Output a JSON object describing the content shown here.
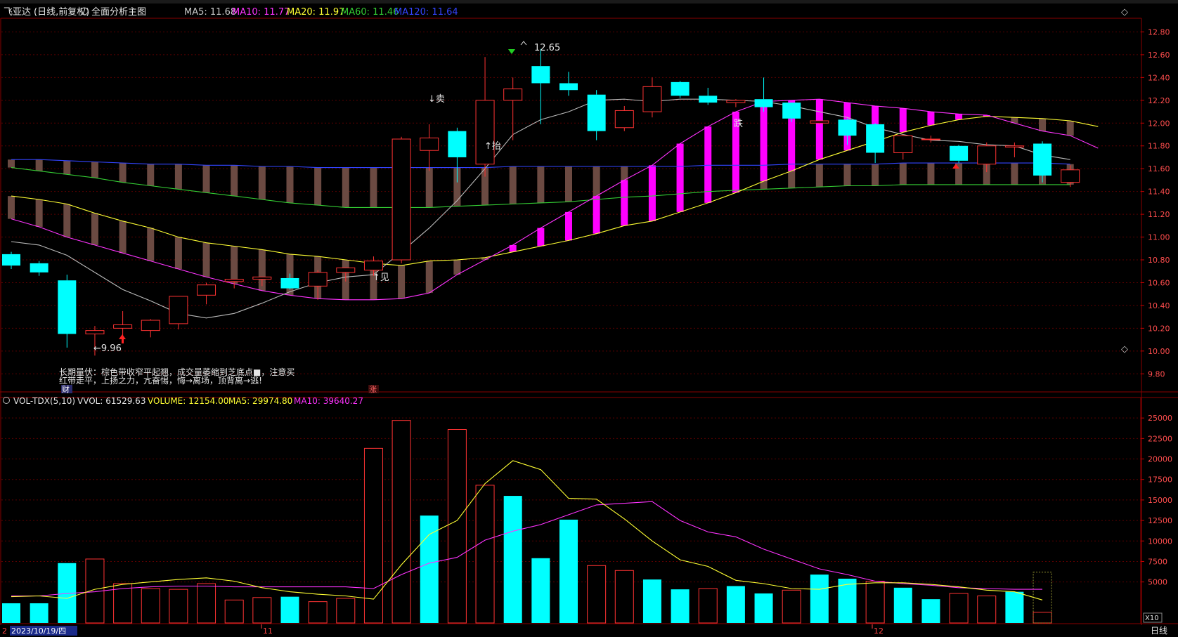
{
  "header": {
    "stock_name": "飞亚达",
    "period": "(日线,前复权)",
    "view_label": "全面分析主图",
    "ma": [
      {
        "label": "MA5: 11.68",
        "color": "#c8c8c8"
      },
      {
        "label": "MA10: 11.77",
        "color": "#ff33ff"
      },
      {
        "label": "MA20: 11.97",
        "color": "#ffff33"
      },
      {
        "label": "MA60: 11.46",
        "color": "#33cc33"
      },
      {
        "label": "MA120: 11.64",
        "color": "#3344ff"
      }
    ]
  },
  "price_axis": {
    "ticks": [
      "12.80",
      "12.60",
      "12.40",
      "12.20",
      "12.00",
      "11.80",
      "11.60",
      "11.40",
      "11.20",
      "11.00",
      "10.80",
      "10.60",
      "10.40",
      "10.20",
      "10.00",
      "9.80"
    ]
  },
  "annotations": {
    "high_label": "12.65",
    "low_label": "←9.96",
    "sell": "↓卖",
    "lift": "↑抬",
    "see": "↑见",
    "jump": "跌",
    "note_line1": "长期量伏：棕色带收窄平起翘，成交量萎缩到芝底点■，注意买",
    "note_line2": "红带走平，上扬之力，亢奋惕，悔→离场，顶背离→逃!",
    "cai": "财",
    "zhang": "涨"
  },
  "volume_header": {
    "title": "VOL-TDX(5,10)",
    "vvol": "VVOL: 61529.63",
    "volume": "VOLUME: 12154.00",
    "ma5": "MA5: 29974.80",
    "ma10": "MA10: 39640.27"
  },
  "volume_axis": {
    "ticks": [
      "25000",
      "22500",
      "20000",
      "17500",
      "15000",
      "12500",
      "10000",
      "7500",
      "5000"
    ],
    "unit": "X10"
  },
  "date_axis": {
    "current_date": "2023/10/19/四",
    "month_11": "11",
    "month_12": "12",
    "first_tick": "2"
  },
  "bottom_tab": "日线",
  "colors": {
    "up": "#ff3333",
    "down": "#00ffff",
    "bg": "#000000",
    "grid": "#5a0000",
    "ribbon_brown": "#6b4a42",
    "ribbon_magenta": "#ff00ff"
  },
  "chart_data": {
    "type": "candlestick",
    "price_ylim": [
      9.66,
      12.92
    ],
    "candles": [
      {
        "o": 10.85,
        "h": 10.87,
        "l": 10.72,
        "c": 10.75
      },
      {
        "o": 10.77,
        "h": 10.79,
        "l": 10.66,
        "c": 10.69
      },
      {
        "o": 10.62,
        "h": 10.67,
        "l": 10.03,
        "c": 10.15
      },
      {
        "o": 10.15,
        "h": 10.22,
        "l": 9.96,
        "c": 10.18
      },
      {
        "o": 10.2,
        "h": 10.35,
        "l": 10.12,
        "c": 10.23
      },
      {
        "o": 10.18,
        "h": 10.28,
        "l": 10.12,
        "c": 10.27
      },
      {
        "o": 10.24,
        "h": 10.48,
        "l": 10.19,
        "c": 10.48
      },
      {
        "o": 10.49,
        "h": 10.6,
        "l": 10.41,
        "c": 10.58
      },
      {
        "o": 10.61,
        "h": 10.62,
        "l": 10.55,
        "c": 10.63
      },
      {
        "o": 10.63,
        "h": 10.65,
        "l": 10.57,
        "c": 10.65
      },
      {
        "o": 10.64,
        "h": 10.68,
        "l": 10.54,
        "c": 10.55
      },
      {
        "o": 10.57,
        "h": 10.71,
        "l": 10.45,
        "c": 10.69
      },
      {
        "o": 10.69,
        "h": 10.72,
        "l": 10.61,
        "c": 10.73
      },
      {
        "o": 10.71,
        "h": 10.83,
        "l": 10.66,
        "c": 10.79
      },
      {
        "o": 10.8,
        "h": 11.88,
        "l": 10.77,
        "c": 11.86
      },
      {
        "o": 11.76,
        "h": 11.99,
        "l": 11.58,
        "c": 11.87
      },
      {
        "o": 11.93,
        "h": 11.96,
        "l": 11.48,
        "c": 11.7
      },
      {
        "o": 11.64,
        "h": 12.58,
        "l": 11.53,
        "c": 12.2
      },
      {
        "o": 12.2,
        "h": 12.4,
        "l": 11.85,
        "c": 12.3
      },
      {
        "o": 12.5,
        "h": 12.65,
        "l": 11.99,
        "c": 12.35
      },
      {
        "o": 12.35,
        "h": 12.45,
        "l": 12.24,
        "c": 12.29
      },
      {
        "o": 12.25,
        "h": 12.29,
        "l": 11.85,
        "c": 11.93
      },
      {
        "o": 11.96,
        "h": 12.15,
        "l": 11.93,
        "c": 12.11
      },
      {
        "o": 12.1,
        "h": 12.4,
        "l": 12.05,
        "c": 12.32
      },
      {
        "o": 12.36,
        "h": 12.37,
        "l": 12.22,
        "c": 12.24
      },
      {
        "o": 12.24,
        "h": 12.31,
        "l": 12.16,
        "c": 12.18
      },
      {
        "o": 12.18,
        "h": 12.21,
        "l": 12.14,
        "c": 12.2
      },
      {
        "o": 12.21,
        "h": 12.4,
        "l": 12.1,
        "c": 12.14
      },
      {
        "o": 12.18,
        "h": 12.18,
        "l": 12.01,
        "c": 12.04
      },
      {
        "o": 12.0,
        "h": 12.02,
        "l": 11.99,
        "c": 12.02
      },
      {
        "o": 12.03,
        "h": 12.04,
        "l": 11.81,
        "c": 11.89
      },
      {
        "o": 11.99,
        "h": 12.0,
        "l": 11.65,
        "c": 11.74
      },
      {
        "o": 11.74,
        "h": 11.9,
        "l": 11.68,
        "c": 11.89
      },
      {
        "o": 11.86,
        "h": 11.89,
        "l": 11.83,
        "c": 11.86
      },
      {
        "o": 11.8,
        "h": 11.81,
        "l": 11.65,
        "c": 11.67
      },
      {
        "o": 11.64,
        "h": 11.83,
        "l": 11.57,
        "c": 11.8
      },
      {
        "o": 11.79,
        "h": 11.83,
        "l": 11.7,
        "c": 11.8
      },
      {
        "o": 11.82,
        "h": 11.84,
        "l": 11.48,
        "c": 11.54
      },
      {
        "o": 11.48,
        "h": 11.63,
        "l": 11.44,
        "c": 11.59
      }
    ],
    "ma5": [
      10.96,
      10.93,
      10.84,
      10.69,
      10.54,
      10.44,
      10.33,
      10.29,
      10.33,
      10.42,
      10.52,
      10.6,
      10.65,
      10.67,
      10.87,
      11.08,
      11.32,
      11.6,
      11.9,
      12.03,
      12.1,
      12.2,
      12.21,
      12.19,
      12.21,
      12.21,
      12.2,
      12.19,
      12.15,
      12.1,
      12.05,
      11.96,
      11.9,
      11.85,
      11.84,
      11.81,
      11.8,
      11.72,
      11.68
    ],
    "ma10": [
      11.16,
      11.09,
      11.0,
      10.93,
      10.86,
      10.79,
      10.72,
      10.65,
      10.59,
      10.53,
      10.49,
      10.46,
      10.45,
      10.45,
      10.46,
      10.51,
      10.67,
      10.8,
      10.93,
      11.08,
      11.22,
      11.36,
      11.5,
      11.63,
      11.82,
      11.97,
      12.1,
      12.19,
      12.2,
      12.21,
      12.18,
      12.15,
      12.13,
      12.1,
      12.08,
      12.07,
      12.0,
      11.93,
      11.89,
      11.78
    ],
    "ma20": [
      11.36,
      11.33,
      11.29,
      11.21,
      11.14,
      11.08,
      11.0,
      10.95,
      10.92,
      10.89,
      10.85,
      10.83,
      10.8,
      10.77,
      10.75,
      10.79,
      10.8,
      10.82,
      10.87,
      10.92,
      10.97,
      11.03,
      11.1,
      11.14,
      11.22,
      11.3,
      11.39,
      11.49,
      11.58,
      11.68,
      11.76,
      11.84,
      11.92,
      11.98,
      12.03,
      12.06,
      12.05,
      12.04,
      12.02,
      11.97
    ],
    "ma60": [
      11.61,
      11.58,
      11.55,
      11.52,
      11.48,
      11.45,
      11.42,
      11.39,
      11.36,
      11.33,
      11.3,
      11.28,
      11.26,
      11.26,
      11.26,
      11.26,
      11.27,
      11.28,
      11.29,
      11.3,
      11.31,
      11.33,
      11.35,
      11.36,
      11.38,
      11.4,
      11.41,
      11.42,
      11.43,
      11.44,
      11.45,
      11.45,
      11.46,
      11.46,
      11.46,
      11.46,
      11.46,
      11.46,
      11.46
    ],
    "ma120": [
      11.68,
      11.68,
      11.67,
      11.66,
      11.65,
      11.64,
      11.64,
      11.63,
      11.63,
      11.62,
      11.62,
      11.61,
      11.61,
      11.61,
      11.61,
      11.61,
      11.61,
      11.61,
      11.62,
      11.62,
      11.62,
      11.62,
      11.62,
      11.62,
      11.62,
      11.63,
      11.63,
      11.63,
      11.64,
      11.64,
      11.64,
      11.64,
      11.65,
      11.65,
      11.65,
      11.65,
      11.65,
      11.65,
      11.64
    ],
    "volume_ylim": [
      0,
      26300
    ],
    "volumes": [
      2400,
      2400,
      7300,
      7800,
      4800,
      4200,
      4100,
      4800,
      2800,
      3100,
      3200,
      2600,
      3000,
      21300,
      24700,
      13100,
      23600,
      16800,
      15500,
      7900,
      12600,
      7000,
      6400,
      5300,
      4100,
      4200,
      4500,
      3600,
      4000,
      5900,
      5400,
      5100,
      4300,
      2900,
      3600,
      3300,
      3800,
      1300
    ],
    "volume_up": [
      false,
      false,
      false,
      true,
      true,
      true,
      true,
      true,
      true,
      true,
      false,
      true,
      true,
      true,
      true,
      false,
      true,
      true,
      false,
      false,
      false,
      true,
      true,
      false,
      false,
      true,
      false,
      false,
      true,
      false,
      false,
      true,
      false,
      false,
      true,
      true,
      false,
      true
    ],
    "vol_ma5": [
      3200,
      3300,
      3000,
      4100,
      4700,
      5000,
      5300,
      5500,
      5100,
      4300,
      3800,
      3500,
      3300,
      2900,
      7100,
      10800,
      12500,
      17000,
      19800,
      18700,
      15200,
      15100,
      12700,
      10000,
      7700,
      6900,
      5200,
      4800,
      4200,
      4100,
      4700,
      4900,
      4900,
      4700,
      4400,
      4000,
      3800,
      2800
    ],
    "vol_ma10": [
      3300,
      3300,
      3600,
      3800,
      4200,
      4400,
      4500,
      4500,
      4400,
      4400,
      4400,
      4400,
      4400,
      4200,
      5900,
      7300,
      8000,
      10100,
      11200,
      12000,
      13200,
      14400,
      14600,
      14800,
      12500,
      11100,
      10500,
      9000,
      7800,
      6600,
      5900,
      5100,
      4800,
      4600,
      4300,
      4200,
      4100,
      4100
    ]
  }
}
